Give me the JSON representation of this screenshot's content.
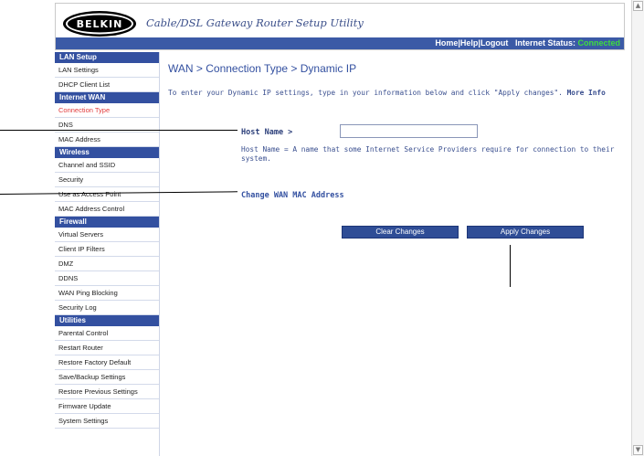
{
  "header": {
    "logo_text": "BELKIN",
    "app_title": "Cable/DSL Gateway Router Setup Utility",
    "links": [
      "Home",
      "Help",
      "Logout"
    ],
    "status_label": "Internet Status:",
    "status_value": "Connected"
  },
  "sidebar": {
    "sections": [
      {
        "title": "LAN Setup",
        "items": [
          "LAN Settings",
          "DHCP Client List"
        ]
      },
      {
        "title": "Internet WAN",
        "items": [
          "Connection Type",
          "DNS",
          "MAC Address"
        ]
      },
      {
        "title": "Wireless",
        "items": [
          "Channel and SSID",
          "Security",
          "Use as Access Point",
          "MAC Address Control"
        ]
      },
      {
        "title": "Firewall",
        "items": [
          "Virtual Servers",
          "Client IP Filters",
          "DMZ",
          "DDNS",
          "WAN Ping Blocking",
          "Security Log"
        ]
      },
      {
        "title": "Utilities",
        "items": [
          "Parental Control",
          "Restart Router",
          "Restore Factory Default",
          "Save/Backup Settings",
          "Restore Previous Settings",
          "Firmware Update",
          "System Settings"
        ]
      }
    ],
    "active_item": "Connection Type"
  },
  "main": {
    "title": "WAN > Connection Type > Dynamic IP",
    "intro": "To enter your Dynamic IP settings, type in your information below and click \"Apply changes\".",
    "more_info": "More Info",
    "host_label": "Host Name >",
    "host_value": "",
    "host_description": "Host Name = A name that some Internet Service Providers require for connection to their system.",
    "mac_link": "Change WAN MAC Address",
    "clear_button": "Clear Changes",
    "apply_button": "Apply Changes"
  },
  "colors": {
    "accent": "#3350a0",
    "status": "#3fdc3f",
    "active_nav": "#e23b3b"
  }
}
